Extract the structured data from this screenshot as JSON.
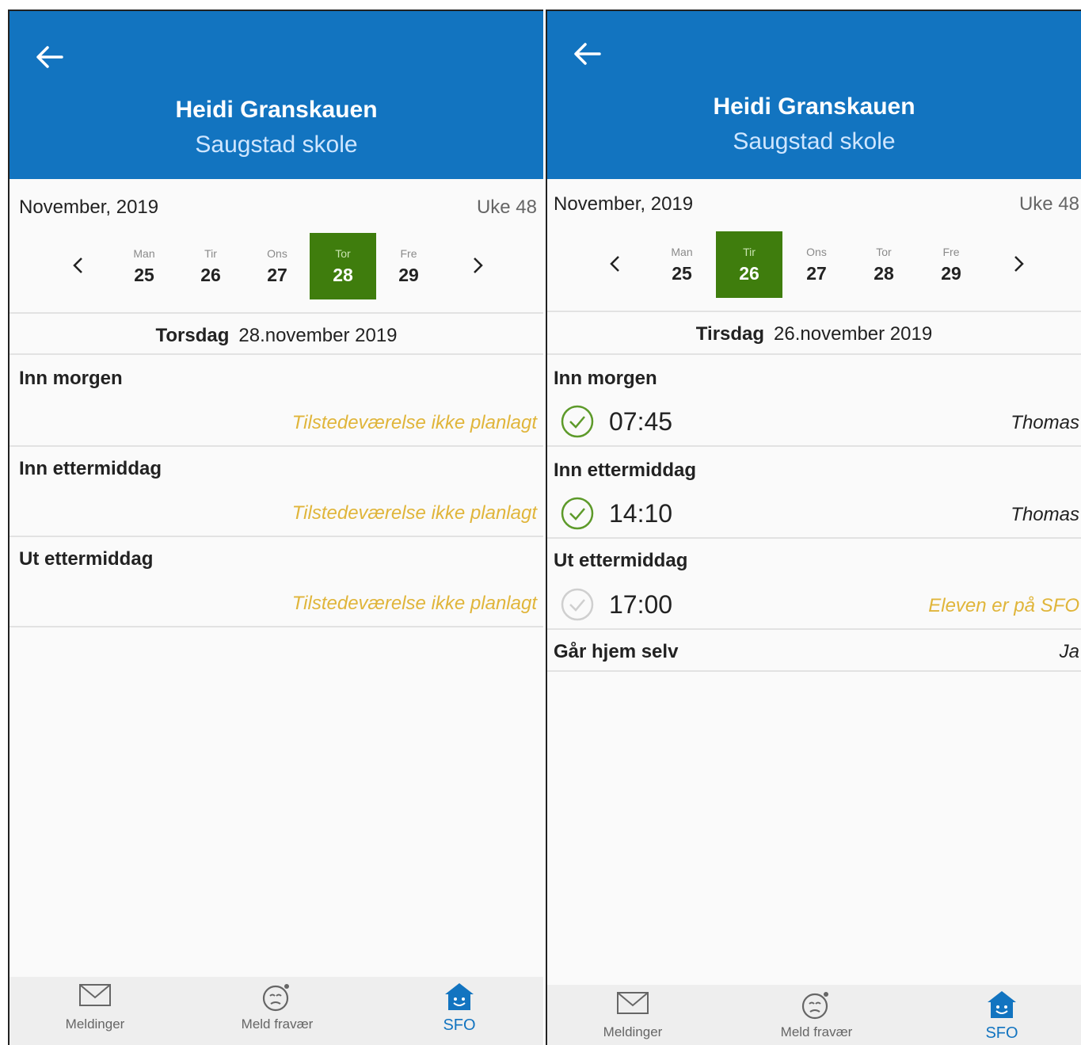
{
  "header": {
    "student_name": "Heidi Granskauen",
    "school": "Saugstad skole"
  },
  "colors": {
    "header_blue": "#1274c0",
    "selected_green": "#3f7d0d",
    "note_yellow": "#e0b53a",
    "check_green": "#5d9a2a"
  },
  "screens": [
    {
      "month": "November, 2019",
      "week": "Uke 48",
      "days": [
        {
          "name": "Man",
          "date": "25"
        },
        {
          "name": "Tir",
          "date": "26"
        },
        {
          "name": "Ons",
          "date": "27"
        },
        {
          "name": "Tor",
          "date": "28"
        },
        {
          "name": "Fre",
          "date": "29"
        }
      ],
      "selected_day": "Tor",
      "date_weekday": "Torsdag",
      "date_rest": "28.november 2019",
      "sections": [
        {
          "title": "Inn morgen",
          "note": "Tilstedeværelse ikke planlagt"
        },
        {
          "title": "Inn ettermiddag",
          "note": "Tilstedeværelse ikke planlagt"
        },
        {
          "title": "Ut ettermiddag",
          "note": "Tilstedeværelse ikke planlagt"
        }
      ]
    },
    {
      "month": "November, 2019",
      "week": "Uke 48",
      "days": [
        {
          "name": "Man",
          "date": "25"
        },
        {
          "name": "Tir",
          "date": "26"
        },
        {
          "name": "Ons",
          "date": "27"
        },
        {
          "name": "Tor",
          "date": "28"
        },
        {
          "name": "Fre",
          "date": "29"
        }
      ],
      "selected_day": "Tir",
      "date_weekday": "Tirsdag",
      "date_rest": "26.november 2019",
      "sections": [
        {
          "title": "Inn morgen",
          "time": "07:45",
          "person": "Thomas",
          "status": "checked"
        },
        {
          "title": "Inn ettermiddag",
          "time": "14:10",
          "person": "Thomas",
          "status": "checked"
        },
        {
          "title": "Ut ettermiddag",
          "time": "17:00",
          "note": "Eleven er på SFO",
          "status": "pending"
        },
        {
          "title": "Går hjem selv",
          "value": "Ja"
        }
      ]
    }
  ],
  "nav": {
    "messages_label": "Meldinger",
    "absence_label": "Meld fravær",
    "sfo_label": "SFO"
  }
}
